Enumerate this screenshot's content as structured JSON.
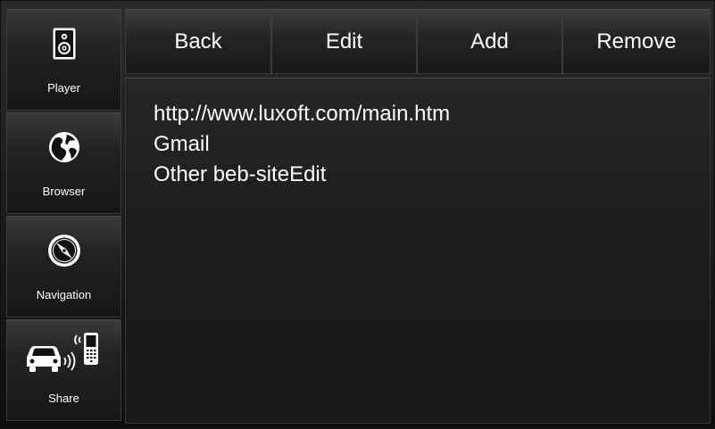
{
  "sidebar": {
    "items": [
      {
        "label": "Player",
        "icon": "speaker-icon"
      },
      {
        "label": "Browser",
        "icon": "globe-icon"
      },
      {
        "label": "Navigation",
        "icon": "compass-icon"
      },
      {
        "label": "Share",
        "icon": "car-phone-icon"
      }
    ]
  },
  "toolbar": {
    "back_label": "Back",
    "edit_label": "Edit",
    "add_label": "Add",
    "remove_label": "Remove"
  },
  "bookmarks": {
    "items": [
      "http://www.luxoft.com/main.htm",
      "Gmail",
      "Other beb-siteEdit"
    ]
  },
  "colors": {
    "text": "#ffffff",
    "background": "#1b1b1b",
    "button_top": "#3c3c3c",
    "button_bottom": "#171717"
  }
}
